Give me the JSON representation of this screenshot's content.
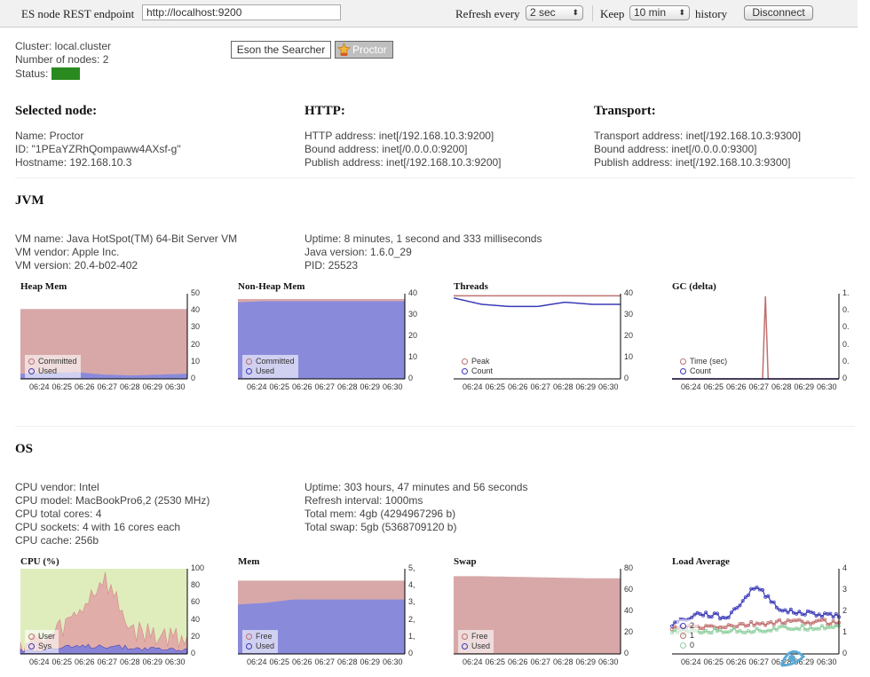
{
  "toolbar": {
    "endpoint_label": "ES node REST endpoint",
    "endpoint_value": "http://localhost:9200",
    "refresh_label": "Refresh every",
    "refresh_value": "2 sec",
    "keep_label": "Keep",
    "keep_value": "10 min",
    "history_label": "history",
    "disconnect_label": "Disconnect"
  },
  "cluster": {
    "name_line": "Cluster: local.cluster",
    "nodes_line": "Number of nodes: 2",
    "status_label": "Status:",
    "status_value": "green"
  },
  "nodes": [
    "Eson the Searcher",
    "Proctor"
  ],
  "selected_node": {
    "heading": "Selected node:",
    "name": "Name: Proctor",
    "id": "ID: \"1PEaYZRhQompaww4AXsf-g\"",
    "hostname": "Hostname: 192.168.10.3"
  },
  "http": {
    "heading": "HTTP:",
    "address": "HTTP address: inet[/192.168.10.3:9200]",
    "bound": "Bound address: inet[/0.0.0.0:9200]",
    "publish": "Publish address: inet[/192.168.10.3:9200]"
  },
  "transport": {
    "heading": "Transport:",
    "address": "Transport address: inet[/192.168.10.3:9300]",
    "bound": "Bound address: inet[/0.0.0.0:9300]",
    "publish": "Publish address: inet[/192.168.10.3:9300]"
  },
  "jvm": {
    "heading": "JVM",
    "vm_name": "VM name: Java HotSpot(TM) 64-Bit Server VM",
    "vm_vendor": "VM vendor: Apple Inc.",
    "vm_version": "VM version: 20.4-b02-402",
    "uptime": "Uptime: 8 minutes, 1 second and 333 milliseconds",
    "java_version": "Java version: 1.6.0_29",
    "pid": "PID: 25523"
  },
  "os": {
    "heading": "OS",
    "cpu_vendor": "CPU vendor: Intel",
    "cpu_model": "CPU model: MacBookPro6,2 (2530 MHz)",
    "cpu_total_cores": "CPU total cores: 4",
    "cpu_sockets": "CPU sockets: 4 with 16 cores each",
    "cpu_cache": "CPU cache: 256b",
    "uptime": "Uptime: 303 hours, 47 minutes and 56 seconds",
    "refresh_interval": "Refresh interval: 1000ms",
    "total_mem": "Total mem: 4gb (4294967296 b)",
    "total_swap": "Total swap: 5gb (5368709120 b)"
  },
  "colors": {
    "red_fill": "#d8a8a8",
    "blue_fill": "#8a8adb",
    "red_line": "#c07070",
    "blue_line": "#3a3ab8",
    "green_bg": "#dfedbd",
    "green_line": "#8fce9f"
  },
  "x_ticks": [
    "06:24",
    "06:25",
    "06:26",
    "06:27",
    "06:28",
    "06:29",
    "06:30"
  ],
  "chart_data": [
    {
      "type": "area",
      "title": "Heap Mem",
      "categories": [
        "06:24",
        "06:25",
        "06:26",
        "06:27",
        "06:28",
        "06:29",
        "06:30"
      ],
      "ylim": [
        0,
        50
      ],
      "yticks": [
        "50",
        "40",
        "30",
        "20",
        "10",
        "0"
      ],
      "series": [
        {
          "name": "Committed",
          "values": [
            41,
            41,
            41,
            41,
            41,
            41,
            41
          ]
        },
        {
          "name": "Used",
          "values": [
            3,
            3.5,
            4,
            2.5,
            2,
            2.5,
            3
          ]
        }
      ],
      "legend": "bottom-left"
    },
    {
      "type": "area",
      "title": "Non-Heap Mem",
      "categories": [
        "06:24",
        "06:25",
        "06:26",
        "06:27",
        "06:28",
        "06:29",
        "06:30"
      ],
      "ylim": [
        0,
        40
      ],
      "yticks": [
        "40",
        "30",
        "20",
        "10",
        "0"
      ],
      "series": [
        {
          "name": "Committed",
          "values": [
            37.5,
            37.5,
            37.5,
            37.5,
            37.5,
            37.5,
            37.5
          ]
        },
        {
          "name": "Used",
          "values": [
            36,
            36.5,
            36.5,
            36.5,
            36.5,
            36.5,
            36.5
          ]
        }
      ],
      "legend": "bottom-left"
    },
    {
      "type": "line",
      "title": "Threads",
      "categories": [
        "06:24",
        "06:25",
        "06:26",
        "06:27",
        "06:28",
        "06:29",
        "06:30"
      ],
      "ylim": [
        0,
        40
      ],
      "yticks": [
        "40",
        "30",
        "20",
        "10",
        "0"
      ],
      "series": [
        {
          "name": "Peak",
          "values": [
            39,
            39,
            39,
            39,
            39,
            39,
            39
          ]
        },
        {
          "name": "Count",
          "values": [
            38,
            35,
            34,
            34,
            36,
            35,
            35
          ]
        }
      ],
      "legend": "bottom-left"
    },
    {
      "type": "line",
      "title": "GC (delta)",
      "categories": [
        "06:24",
        "06:25",
        "06:26",
        "06:27",
        "06:28",
        "06:29",
        "06:30"
      ],
      "ylim": [
        0,
        1
      ],
      "yticks": [
        "1.",
        "0.",
        "0.",
        "0.",
        "0.",
        "0"
      ],
      "series": [
        {
          "name": "Time (sec)",
          "values": [
            0,
            0,
            0,
            0.97,
            0,
            0,
            0
          ]
        },
        {
          "name": "Count",
          "values": [
            0,
            0,
            0,
            0,
            0,
            0,
            0
          ]
        }
      ],
      "legend": "bottom-left"
    },
    {
      "type": "area",
      "title": "CPU (%)",
      "categories": [
        "06:24",
        "06:25",
        "06:26",
        "06:27",
        "06:28",
        "06:29",
        "06:30"
      ],
      "ylim": [
        0,
        100
      ],
      "yticks": [
        "100",
        "80",
        "60",
        "40",
        "20",
        "0"
      ],
      "series": [
        {
          "name": "User",
          "values": [
            12,
            18,
            45,
            90,
            28,
            22,
            20
          ]
        },
        {
          "name": "Sys",
          "values": [
            4,
            6,
            8,
            10,
            7,
            6,
            5
          ]
        }
      ],
      "legend": "bottom-left"
    },
    {
      "type": "area",
      "title": "Mem",
      "categories": [
        "06:24",
        "06:25",
        "06:26",
        "06:27",
        "06:28",
        "06:29",
        "06:30"
      ],
      "ylim": [
        0,
        5
      ],
      "yticks": [
        "5,",
        "4,",
        "3,",
        "2,",
        "1,",
        "0"
      ],
      "series": [
        {
          "name": "Free",
          "values": [
            4.3,
            4.3,
            4.3,
            4.3,
            4.3,
            4.3,
            4.3
          ]
        },
        {
          "name": "Used",
          "values": [
            2.9,
            3.0,
            3.2,
            3.2,
            3.2,
            3.2,
            3.2
          ]
        }
      ],
      "legend": "bottom-left"
    },
    {
      "type": "area",
      "title": "Swap",
      "categories": [
        "06:24",
        "06:25",
        "06:26",
        "06:27",
        "06:28",
        "06:29",
        "06:30"
      ],
      "ylim": [
        0,
        80
      ],
      "yticks": [
        "80",
        "60",
        "40",
        "20",
        "0"
      ],
      "series": [
        {
          "name": "Free",
          "values": [
            73,
            73,
            72.5,
            72,
            71.5,
            71,
            71
          ]
        },
        {
          "name": "Used",
          "values": [
            0,
            0,
            0,
            0,
            0,
            0,
            0
          ]
        }
      ],
      "legend": "bottom-left"
    },
    {
      "type": "line",
      "title": "Load Average",
      "categories": [
        "06:24",
        "06:25",
        "06:26",
        "06:27",
        "06:28",
        "06:29",
        "06:30"
      ],
      "ylim": [
        0,
        4
      ],
      "yticks": [
        "4",
        "3",
        "2",
        "1",
        "0"
      ],
      "series": [
        {
          "name": "2",
          "values": [
            1.4,
            1.9,
            1.7,
            3.2,
            2.0,
            1.9,
            1.8
          ]
        },
        {
          "name": "1",
          "values": [
            1.2,
            1.25,
            1.3,
            1.4,
            1.5,
            1.5,
            1.5
          ]
        },
        {
          "name": "0",
          "values": [
            1.0,
            1.05,
            1.1,
            1.1,
            1.2,
            1.25,
            1.3
          ]
        }
      ],
      "legend": "bottom-left"
    }
  ]
}
